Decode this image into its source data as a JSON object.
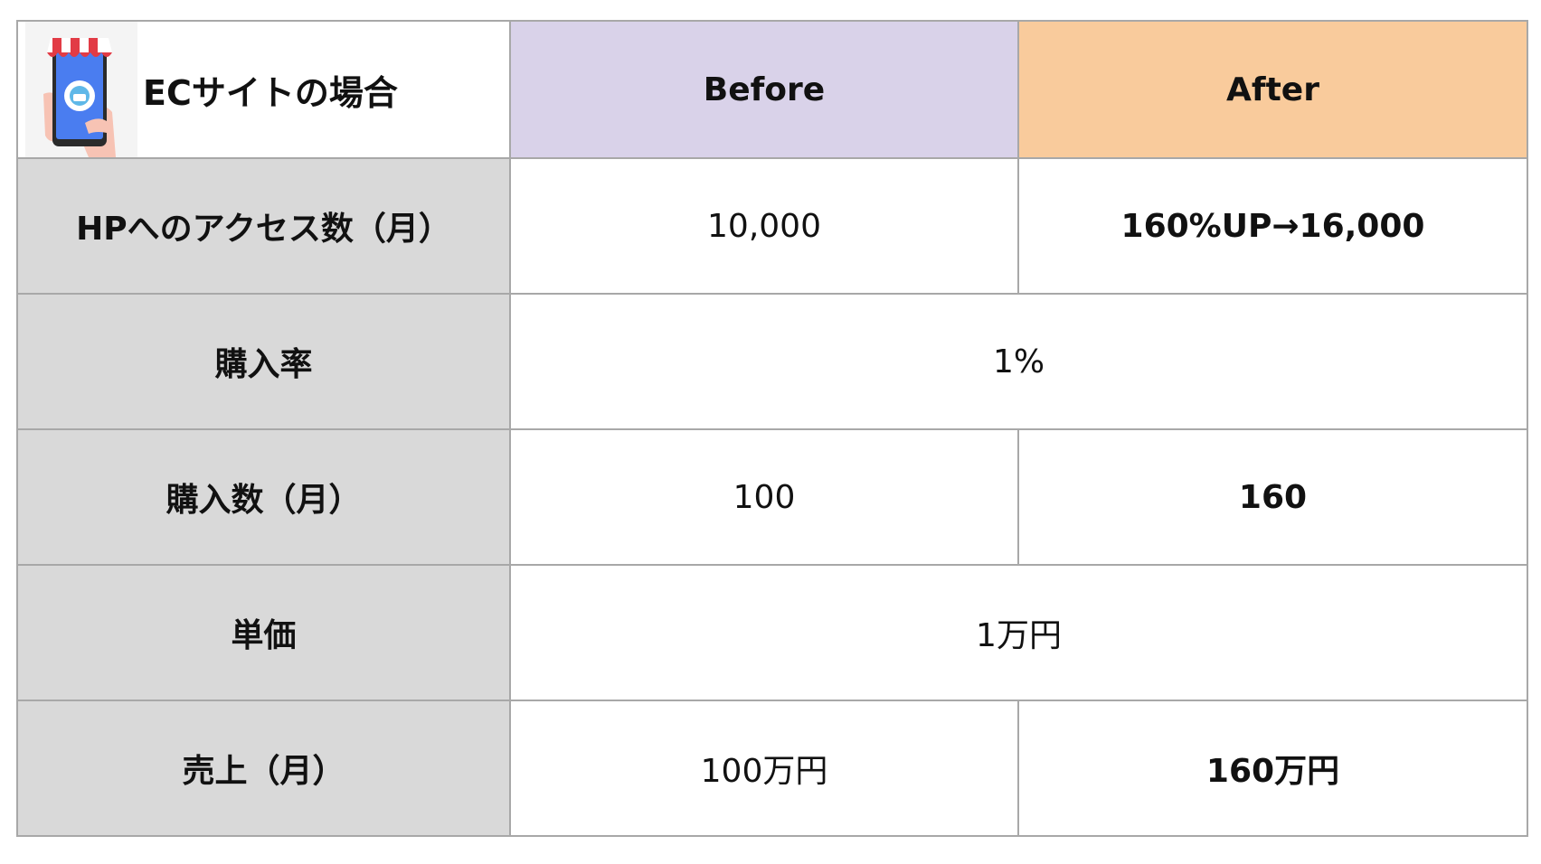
{
  "header": {
    "title": "ECサイトの場合",
    "before": "Before",
    "after": "After",
    "icon": "shop-smartphone-icon"
  },
  "rows": [
    {
      "label": "HPへのアクセス数（月）",
      "before": "10,000",
      "after": "160%UP→16,000"
    },
    {
      "label": "購入率",
      "merged": "1%"
    },
    {
      "label": "購入数（月）",
      "before": "100",
      "after": "160"
    },
    {
      "label": "単価",
      "merged": "1万円"
    },
    {
      "label": "売上（月）",
      "before": "100万円",
      "after": "160万円"
    }
  ],
  "colors": {
    "before_header": "#d9d2e9",
    "after_header": "#f9cb9c",
    "row_label_bg": "#d9d9d9",
    "border": "#a8a8a8"
  }
}
